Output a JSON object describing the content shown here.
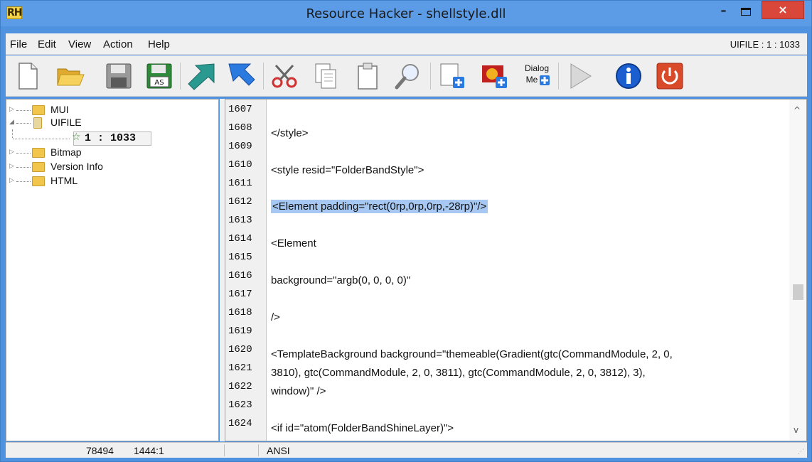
{
  "window": {
    "app_icon_text": "RH",
    "title": "Resource Hacker - shellstyle.dll",
    "minimize": "–",
    "close": "×"
  },
  "menu": {
    "items": [
      "File",
      "Edit",
      "View",
      "Action",
      "Help"
    ],
    "resource_path": "UIFILE : 1 : 1033"
  },
  "toolbar": {
    "buttons": [
      "new-file-icon",
      "open-folder-icon",
      "save-icon",
      "save-as-icon",
      "compile-script-icon",
      "run-script-icon",
      "cut-icon",
      "copy-icon",
      "paste-icon",
      "find-icon",
      "add-resource-icon",
      "add-image-icon",
      "dialog-menu-icon",
      "play-icon",
      "info-icon",
      "power-icon"
    ],
    "as_label": "AS",
    "dialog_label_1": "Dialog",
    "dialog_label_2": "Me"
  },
  "tree": {
    "items": [
      {
        "label": "MUI",
        "expander": "▷"
      },
      {
        "label": "UIFILE",
        "expander": "◢"
      },
      {
        "label": "1 : 1033",
        "expander": ""
      },
      {
        "label": "Bitmap",
        "expander": "▷"
      },
      {
        "label": "Version Info",
        "expander": "▷"
      },
      {
        "label": "HTML",
        "expander": "▷"
      }
    ]
  },
  "editor": {
    "line_numbers": [
      "1607",
      "1608",
      "1609",
      "1610",
      "1611",
      "1612",
      "1613",
      "1614",
      "1615",
      "1616",
      "1617",
      "1618",
      "1619",
      "1620",
      "1621",
      "1622",
      "1623",
      "1624"
    ],
    "lines": [
      "",
      "</style>",
      "",
      "<style resid=\"FolderBandStyle\">",
      "",
      "<Element padding=\"rect(0rp,0rp,0rp,-28rp)\"/>",
      "",
      "<Element",
      "",
      "background=\"argb(0, 0, 0, 0)\"",
      "",
      "/>",
      "",
      "<TemplateBackground background=\"themeable(Gradient(gtc(CommandModule, 2, 0,",
      "3810), gtc(CommandModule, 2, 0, 3811), gtc(CommandModule, 2, 0, 3812), 3),",
      "window)\" />",
      "",
      "<if id=\"atom(FolderBandShineLayer)\">"
    ],
    "selected_line": "1612",
    "scroll_up": "^",
    "scroll_down": "v"
  },
  "status": {
    "offset": "78494",
    "position": "1444:1",
    "encoding": "ANSI"
  },
  "colors": {
    "selection": "#a6c8f2",
    "title_bar": "#5c9ce6",
    "close_button": "#d9463a"
  }
}
